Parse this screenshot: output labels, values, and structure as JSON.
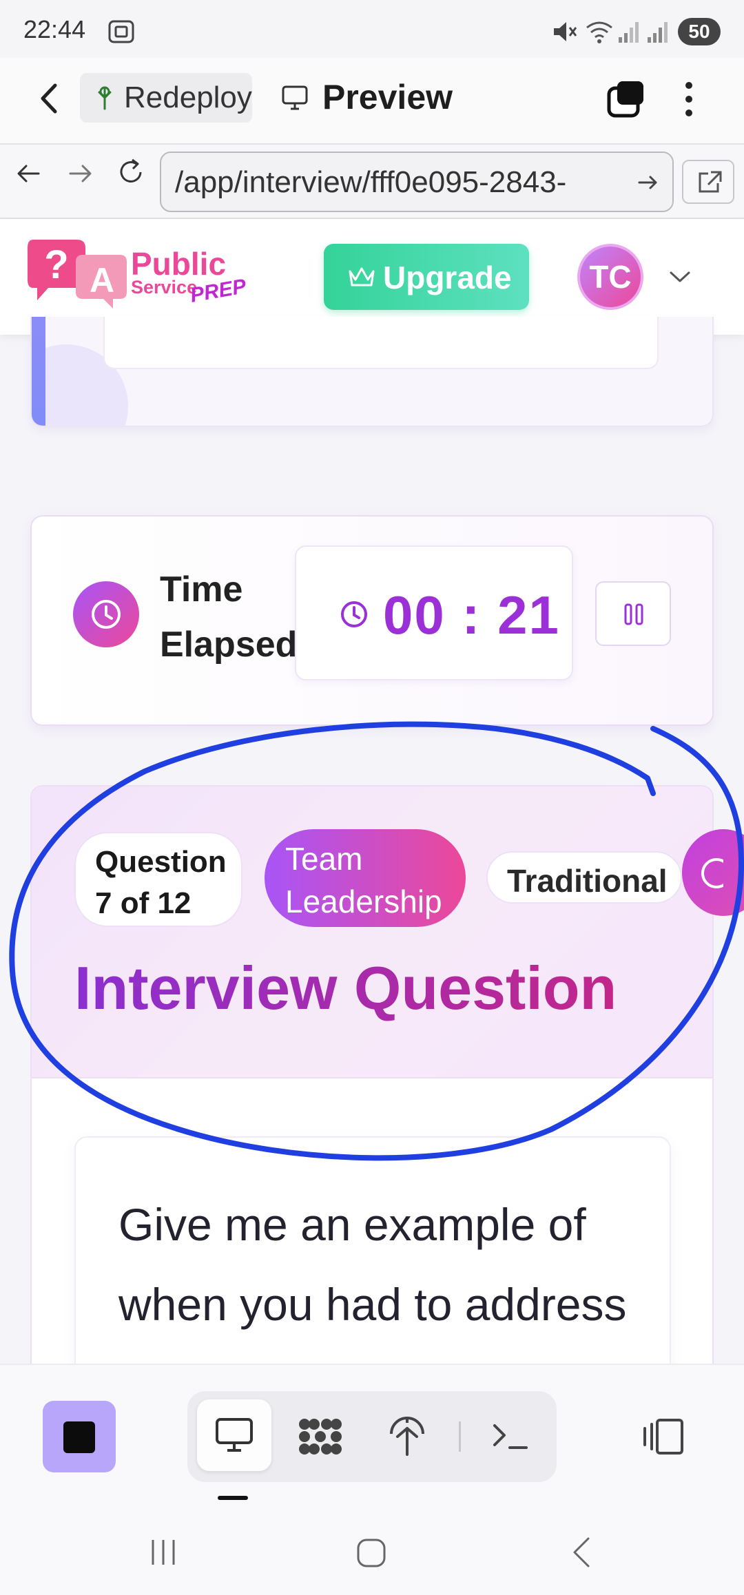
{
  "status_bar": {
    "time": "22:44",
    "battery": "50",
    "icons": [
      "screenshot-icon",
      "mute-icon",
      "wifi-icon",
      "signal-icon",
      "signal-icon"
    ]
  },
  "browser_bar": {
    "tab_label": "Redeploy",
    "preview_label": "Preview",
    "url": "/app/interview/fff0e095-2843-",
    "icons": [
      "back-icon",
      "forward-icon",
      "reload-icon",
      "monitor-icon",
      "tabs-icon",
      "more-icon",
      "open-external-icon",
      "arrow-right-icon"
    ]
  },
  "site_nav": {
    "brand_public": "Public",
    "brand_service": "Service",
    "brand_prep": "PREP",
    "upgrade_label": "Upgrade",
    "avatar_initials": "TC"
  },
  "timer_card": {
    "label": "Time Elapsed",
    "value": "00 : 21"
  },
  "question_card": {
    "badge_number": "Question 7 of 12",
    "badge_category": "Team Leadership",
    "badge_type": "Traditional",
    "title": "Interview Question",
    "text": "Give me an example of when you had to address a significant"
  },
  "colors": {
    "brand_pink": "#ec4899",
    "brand_purple": "#a855f7",
    "upgrade_green": "#34d399",
    "timer_purple": "#9b30d6",
    "annotation_blue": "#1f3fe0"
  }
}
